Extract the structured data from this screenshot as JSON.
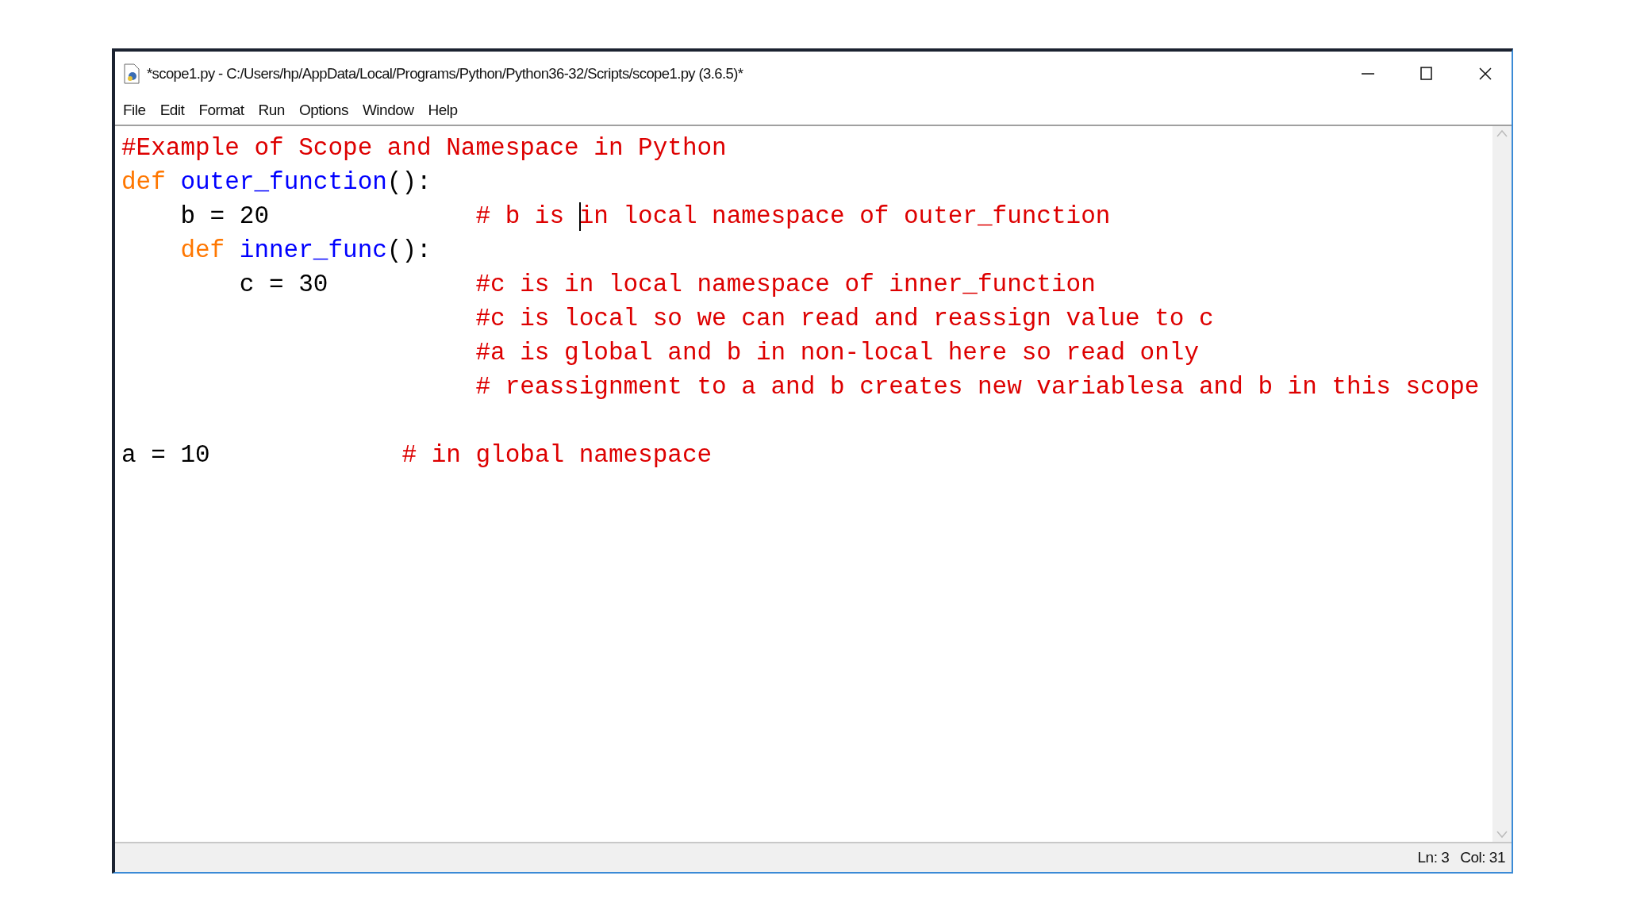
{
  "window": {
    "title": "*scope1.py - C:/Users/hp/AppData/Local/Programs/Python/Python36-32/Scripts/scope1.py (3.6.5)*"
  },
  "menu": [
    "File",
    "Edit",
    "Format",
    "Run",
    "Options",
    "Window",
    "Help"
  ],
  "editor": {
    "lines": [
      {
        "kind": "code",
        "comment": [
          {
            "text": "#Example of Scope and Namespace in Python"
          }
        ]
      },
      {
        "kind": "code",
        "tokens": [
          {
            "kind": "keyword",
            "text": "def"
          },
          {
            "kind": "name",
            "text": "outer_function"
          },
          {
            "kind": "plain",
            "text": "():"
          }
        ],
        "children": [
          {
            "kind": "code",
            "tokens": [
              {
                "kind": "plain",
                "text": "b = 20"
              }
            ],
            "comment": [
              {
                "text": "# b is"
              },
              {
                "text": "in local namespace of outer_function",
                "cursor_before": true
              }
            ]
          },
          {
            "kind": "code",
            "tokens": [
              {
                "kind": "keyword",
                "text": "def"
              },
              {
                "kind": "name",
                "text": "inner_func"
              },
              {
                "kind": "plain",
                "text": "():"
              }
            ],
            "children": [
              {
                "kind": "code",
                "tokens": [
                  {
                    "kind": "plain",
                    "text": "c = 30"
                  }
                ],
                "comment": [
                  {
                    "text": "#c is in local namespace of inner_function"
                  }
                ]
              },
              {
                "kind": "code",
                "comment": [
                  {
                    "text": "#c is local so we can read and reassign value to c"
                  }
                ]
              },
              {
                "kind": "code",
                "comment": [
                  {
                    "text": "#a is global and b in non-local here so read only"
                  }
                ]
              },
              {
                "kind": "code",
                "comment": [
                  {
                    "text": "# reassignment to a and b creates new variablesa and b in this scope"
                  }
                ]
              }
            ]
          }
        ]
      },
      {
        "kind": "blank"
      },
      {
        "kind": "code",
        "tokens": [
          {
            "kind": "plain",
            "text": "a = 10"
          }
        ],
        "comment": [
          {
            "text": "# in global namespace"
          }
        ]
      }
    ]
  },
  "status_bar": {
    "line": "Ln: 3",
    "column": "Col: 31"
  }
}
